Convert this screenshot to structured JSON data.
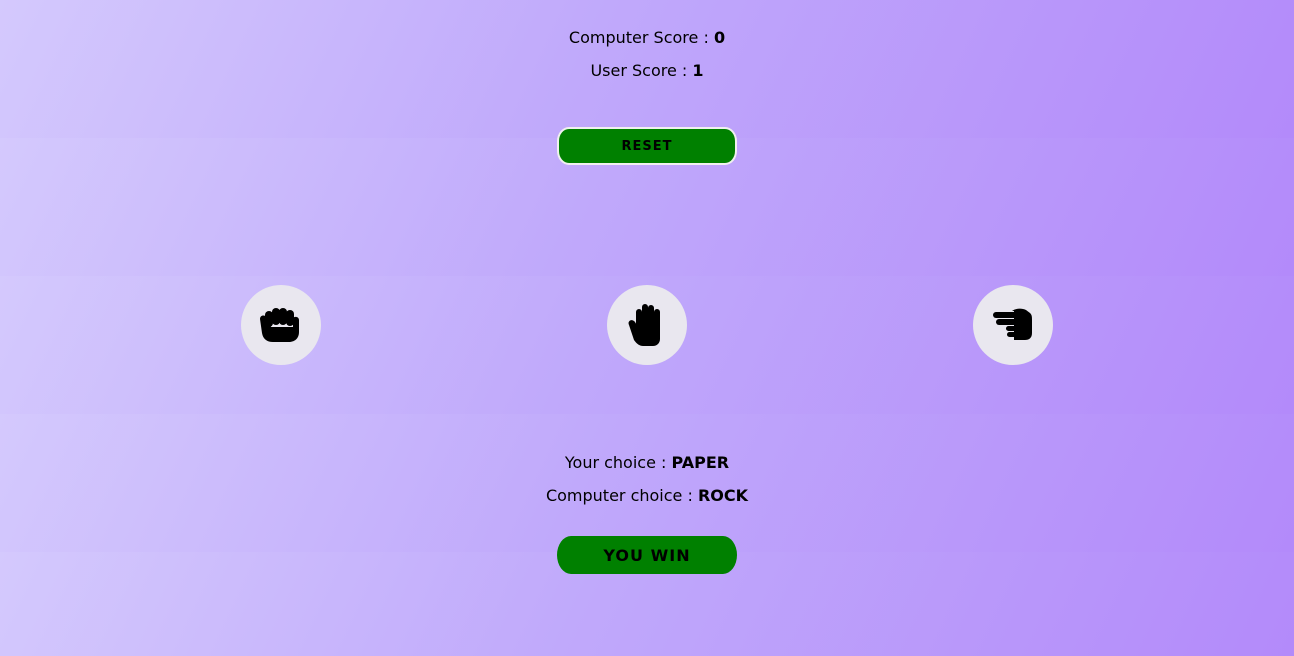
{
  "scoreboard": {
    "computer_label": "Computer Score :",
    "computer_score": "0",
    "user_label": "User Score :",
    "user_score": "1"
  },
  "reset": {
    "label": "RESET",
    "color": "#008000"
  },
  "choices": [
    {
      "name": "rock",
      "icon": "hand-rock-icon"
    },
    {
      "name": "paper",
      "icon": "hand-paper-icon"
    },
    {
      "name": "scissors",
      "icon": "hand-scissors-icon"
    }
  ],
  "result": {
    "your_choice_label": "Your choice :",
    "your_choice": "PAPER",
    "computer_choice_label": "Computer choice :",
    "computer_choice": "ROCK",
    "outcome": "YOU WIN",
    "outcome_color": "#008000"
  },
  "theme": {
    "background_start": "#d4c9fd",
    "background_end": "#b38afa",
    "choice_circle": "#e9e7ef"
  }
}
